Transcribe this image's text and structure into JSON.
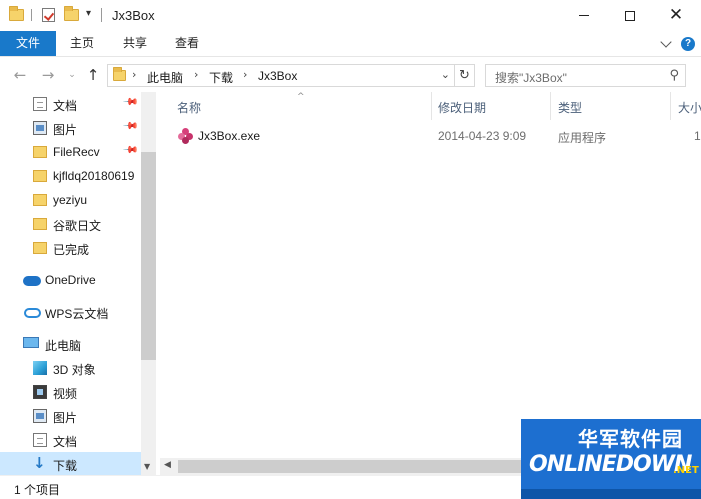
{
  "window": {
    "title": "Jx3Box",
    "qa_dropdown": "▾",
    "minimize_label": "",
    "close_glyph": "✕"
  },
  "ribbon": {
    "tabs": [
      {
        "label": "文件"
      },
      {
        "label": "主页"
      },
      {
        "label": "共享"
      },
      {
        "label": "查看"
      }
    ],
    "help": "?"
  },
  "nav": {
    "back": "←",
    "forward": "→",
    "recent": "⌄",
    "up": "↑",
    "breadcrumb": [
      "此电脑",
      "下载",
      "Jx3Box"
    ],
    "crumb_sep": "›",
    "dropdown": "⌄",
    "refresh": "↻",
    "search_placeholder": "搜索\"Jx3Box\"",
    "search_icon": "⚲"
  },
  "sidebar": {
    "items": [
      {
        "label": "文档",
        "icon": "document-icon",
        "pinned": true
      },
      {
        "label": "图片",
        "icon": "pictures-icon",
        "pinned": true
      },
      {
        "label": "FileRecv",
        "icon": "folder-icon",
        "pinned": true
      },
      {
        "label": "kjfldq20180619",
        "icon": "folder-icon",
        "pinned": false
      },
      {
        "label": "yeziyu",
        "icon": "folder-icon",
        "pinned": false
      },
      {
        "label": "谷歌日文",
        "icon": "folder-icon",
        "pinned": false
      },
      {
        "label": "已完成",
        "icon": "folder-icon",
        "pinned": false
      },
      {
        "label": "OneDrive",
        "icon": "onedrive-icon",
        "pinned": false
      },
      {
        "label": "WPS云文档",
        "icon": "wps-cloud-icon",
        "pinned": false
      },
      {
        "label": "此电脑",
        "icon": "this-pc-icon",
        "pinned": false
      },
      {
        "label": "3D 对象",
        "icon": "3d-objects-icon",
        "pinned": false
      },
      {
        "label": "视频",
        "icon": "video-icon",
        "pinned": false
      },
      {
        "label": "图片",
        "icon": "pictures-icon",
        "pinned": false
      },
      {
        "label": "文档",
        "icon": "document-icon",
        "pinned": false
      },
      {
        "label": "下载",
        "icon": "download-icon",
        "pinned": false,
        "selected": true
      }
    ],
    "pin_glyph": "📌",
    "down_glyph": "↓",
    "scroll_down": "▼"
  },
  "columns": [
    {
      "label": "名称"
    },
    {
      "label": "修改日期"
    },
    {
      "label": "类型"
    },
    {
      "label": "大小"
    }
  ],
  "sort_indicator": "^",
  "files": [
    {
      "name": "Jx3Box.exe",
      "modified": "2014-04-23 9:09",
      "type": "应用程序",
      "size": "1"
    }
  ],
  "hscroll_left": "◀",
  "status": {
    "count": "1 个项目"
  },
  "watermark": {
    "cn": "华军软件园",
    "en": "ONLINEDOWN",
    "net": ".NET"
  },
  "colors": {
    "accent": "#1979ca",
    "selection": "#cce8ff",
    "folder": "#f6d36a"
  }
}
